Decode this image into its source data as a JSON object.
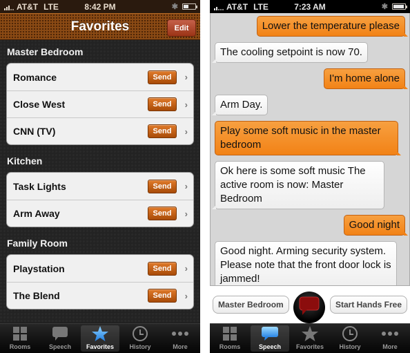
{
  "left": {
    "status": {
      "carrier": "AT&T",
      "network": "LTE",
      "time": "8:42 PM"
    },
    "navbar": {
      "title": "Favorites",
      "edit_label": "Edit"
    },
    "sections": [
      {
        "title": "Master Bedroom",
        "items": [
          {
            "name": "Romance",
            "action": "Send"
          },
          {
            "name": "Close West",
            "action": "Send"
          },
          {
            "name": "CNN (TV)",
            "action": "Send"
          }
        ]
      },
      {
        "title": "Kitchen",
        "items": [
          {
            "name": "Task Lights",
            "action": "Send"
          },
          {
            "name": "Arm Away",
            "action": "Send"
          }
        ]
      },
      {
        "title": "Family Room",
        "items": [
          {
            "name": "Playstation",
            "action": "Send"
          },
          {
            "name": "The Blend",
            "action": "Send"
          }
        ]
      }
    ],
    "tabs": [
      {
        "label": "Rooms",
        "icon": "grid-icon"
      },
      {
        "label": "Speech",
        "icon": "speech-bubble-icon"
      },
      {
        "label": "Favorites",
        "icon": "star-icon",
        "active": true
      },
      {
        "label": "History",
        "icon": "clock-icon"
      },
      {
        "label": "More",
        "icon": "more-dots-icon"
      }
    ]
  },
  "right": {
    "status": {
      "carrier": "AT&T",
      "network": "LTE",
      "time": "7:23 AM"
    },
    "messages": [
      {
        "from": "user",
        "text": "Lower the temperature please"
      },
      {
        "from": "system",
        "text": "The cooling setpoint is now 70."
      },
      {
        "from": "user",
        "text": "I'm home alone"
      },
      {
        "from": "system",
        "text": "Arm Day."
      },
      {
        "from": "user",
        "text": "Play some soft music in the master bedroom"
      },
      {
        "from": "system",
        "text": "Ok here is some soft music The active room is now: Master Bedroom"
      },
      {
        "from": "user",
        "text": "Good night"
      },
      {
        "from": "system",
        "text": "Good night. Arming security system. Please note that the front door lock is jammed!"
      }
    ],
    "room_button": "Master Bedroom",
    "hands_free_button": "Start Hands Free",
    "tabs": [
      {
        "label": "Rooms",
        "icon": "grid-icon"
      },
      {
        "label": "Speech",
        "icon": "speech-bubble-icon",
        "active": true
      },
      {
        "label": "Favorites",
        "icon": "star-icon"
      },
      {
        "label": "History",
        "icon": "clock-icon"
      },
      {
        "label": "More",
        "icon": "more-dots-icon"
      }
    ]
  },
  "colors": {
    "accent_orange": "#f28216",
    "send_button": "#c2600f",
    "edit_button": "#b0462a",
    "mic_bubble": "#8b0d0d"
  }
}
